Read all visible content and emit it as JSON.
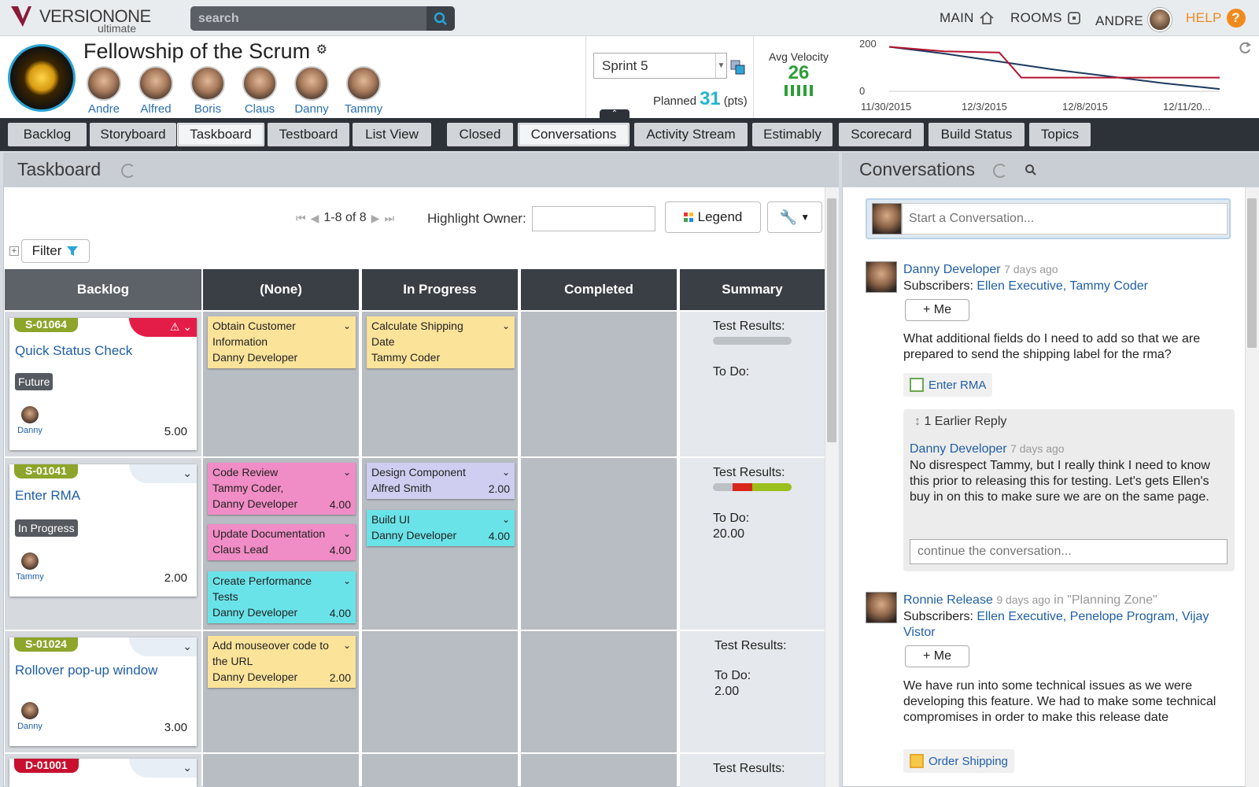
{
  "app": {
    "brand": "VERSIONONE",
    "edition": "ultimate"
  },
  "search": {
    "placeholder": "search"
  },
  "topnav": {
    "main": "MAIN",
    "rooms": "ROOMS",
    "user": "ANDRE",
    "help": "HELP",
    "help_glyph": "?"
  },
  "team": {
    "name": "Fellowship of the Scrum",
    "members": [
      "Andre",
      "Alfred",
      "Boris",
      "Claus",
      "Danny",
      "Tammy"
    ]
  },
  "sprint": {
    "selected": "Sprint 5",
    "planned_label": "Planned",
    "planned_value": "31",
    "planned_unit": "(pts)"
  },
  "velocity": {
    "label": "Avg Velocity",
    "value": "26"
  },
  "burndown": {
    "y_ticks": [
      "200",
      "0"
    ],
    "x_ticks": [
      "11/30/2015",
      "12/3/2015",
      "12/8/2015",
      "12/11/20..."
    ],
    "series": [
      {
        "color": "#1a3a5f",
        "points": [
          [
            0,
            195
          ],
          [
            1,
            165
          ],
          [
            2,
            130
          ],
          [
            3,
            95
          ],
          [
            4,
            65
          ],
          [
            5,
            35
          ],
          [
            6,
            10
          ]
        ]
      },
      {
        "color": "#b3122e",
        "points": [
          [
            0,
            195
          ],
          [
            1,
            175
          ],
          [
            2,
            170
          ],
          [
            2.4,
            60
          ],
          [
            3,
            60
          ],
          [
            4,
            60
          ],
          [
            5,
            60
          ],
          [
            6,
            60
          ]
        ]
      }
    ]
  },
  "tabs": [
    "Backlog",
    "Storyboard",
    "Taskboard",
    "Testboard",
    "List View",
    "Closed",
    "Conversations",
    "Activity Stream",
    "Estimably",
    "Scorecard",
    "Build Status",
    "Topics"
  ],
  "taskboard": {
    "title": "Taskboard",
    "pager": "1-8 of 8",
    "highlight_label": "Highlight Owner:",
    "legend_label": "Legend",
    "filter_label": "Filter",
    "columns": [
      "Backlog",
      "(None)",
      "In Progress",
      "Completed",
      "Summary"
    ],
    "rows": [
      {
        "id": "S-01064",
        "title": "Quick Status Check",
        "status": "Future",
        "owner": "Danny",
        "estimate": "5.00",
        "none": [
          {
            "title": "Obtain Customer Information",
            "owner": "Danny Developer",
            "est": ""
          }
        ],
        "progress": [
          {
            "title": "Calculate Shipping Date",
            "owner": "Tammy Coder",
            "est": ""
          }
        ],
        "summary": {
          "tests": "Test Results:",
          "todo": "To Do:",
          "todo_val": ""
        }
      },
      {
        "id": "S-01041",
        "title": "Enter RMA",
        "status": "In Progress",
        "owner": "Tammy",
        "estimate": "2.00",
        "none": [
          {
            "title": "Code Review",
            "owner": "Tammy Coder, Danny Developer",
            "est": "4.00"
          },
          {
            "title": "Update Documentation",
            "owner": "Claus Lead",
            "est": "4.00"
          },
          {
            "title": "Create Performance Tests",
            "owner": "Danny Developer",
            "est": "4.00"
          }
        ],
        "progress": [
          {
            "title": "Design Component",
            "owner": "Alfred Smith",
            "est": "2.00"
          },
          {
            "title": "Build UI",
            "owner": "Danny Developer",
            "est": "4.00"
          }
        ],
        "summary": {
          "tests": "Test Results:",
          "todo": "To Do:",
          "todo_val": "20.00"
        }
      },
      {
        "id": "S-01024",
        "title": "Rollover pop-up window",
        "status": "",
        "owner": "Danny",
        "estimate": "3.00",
        "none": [
          {
            "title": "Add mouseover code to the URL",
            "owner": "Danny Developer",
            "est": "2.00"
          }
        ],
        "progress": [],
        "summary": {
          "tests": "Test Results:",
          "todo": "To Do:",
          "todo_val": "2.00"
        }
      },
      {
        "id": "D-01001",
        "summary": {
          "tests": "Test Results:"
        }
      }
    ]
  },
  "conversations": {
    "title": "Conversations",
    "start_placeholder": "Start a Conversation...",
    "me_button": "+ Me",
    "posts": [
      {
        "author": "Danny Developer",
        "time": "7 days ago",
        "subscribers_label": "Subscribers:",
        "subscribers": "Ellen Executive, Tammy Coder",
        "text": "What additional fields do I need to add so that we are prepared to send the shipping label for the rma?",
        "chip": "Enter RMA",
        "earlier": "1 Earlier Reply",
        "reply_author": "Danny Developer",
        "reply_time": "7 days ago",
        "reply_text": "No disrespect Tammy, but I really think I need to know this prior to releasing this for testing. Let's gets Ellen's buy in on this to make sure we are on the same page.",
        "continue_placeholder": "continue the conversation..."
      },
      {
        "author": "Ronnie Release",
        "time": "9 days ago",
        "context": "in \"Planning Zone\"",
        "subscribers_label": "Subscribers:",
        "subscribers": "Ellen Executive, Penelope Program, Vijay Vistor",
        "text": "We have run into some technical issues as we were developing this feature. We had to make some technical compromises in order to make this release date",
        "chip": "Order Shipping"
      }
    ]
  }
}
